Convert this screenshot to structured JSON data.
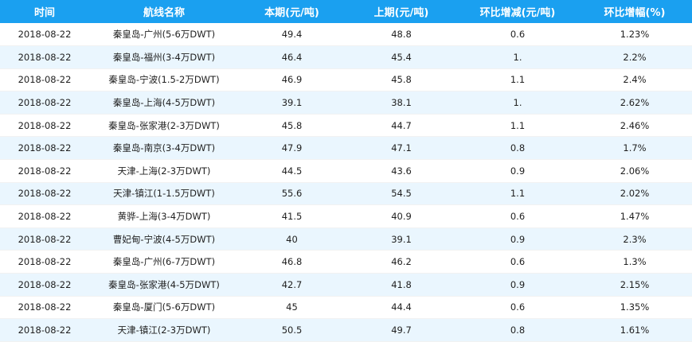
{
  "headers": [
    "时间",
    "航线名称",
    "本期(元/吨)",
    "上期(元/吨)",
    "环比增减(元/吨)",
    "环比增幅(%)"
  ],
  "colors": {
    "header_bg": "#1aa0f0",
    "header_text": "#ffffff",
    "stripe": "#eaf6fe"
  },
  "rows": [
    [
      "2018-08-22",
      "秦皇岛-广州(5-6万DWT)",
      "49.4",
      "48.8",
      "0.6",
      "1.23%"
    ],
    [
      "2018-08-22",
      "秦皇岛-福州(3-4万DWT)",
      "46.4",
      "45.4",
      "1.",
      "2.2%"
    ],
    [
      "2018-08-22",
      "秦皇岛-宁波(1.5-2万DWT)",
      "46.9",
      "45.8",
      "1.1",
      "2.4%"
    ],
    [
      "2018-08-22",
      "秦皇岛-上海(4-5万DWT)",
      "39.1",
      "38.1",
      "1.",
      "2.62%"
    ],
    [
      "2018-08-22",
      "秦皇岛-张家港(2-3万DWT)",
      "45.8",
      "44.7",
      "1.1",
      "2.46%"
    ],
    [
      "2018-08-22",
      "秦皇岛-南京(3-4万DWT)",
      "47.9",
      "47.1",
      "0.8",
      "1.7%"
    ],
    [
      "2018-08-22",
      "天津-上海(2-3万DWT)",
      "44.5",
      "43.6",
      "0.9",
      "2.06%"
    ],
    [
      "2018-08-22",
      "天津-镇江(1-1.5万DWT)",
      "55.6",
      "54.5",
      "1.1",
      "2.02%"
    ],
    [
      "2018-08-22",
      "黄骅-上海(3-4万DWT)",
      "41.5",
      "40.9",
      "0.6",
      "1.47%"
    ],
    [
      "2018-08-22",
      "曹妃甸-宁波(4-5万DWT)",
      "40",
      "39.1",
      "0.9",
      "2.3%"
    ],
    [
      "2018-08-22",
      "秦皇岛-广州(6-7万DWT)",
      "46.8",
      "46.2",
      "0.6",
      "1.3%"
    ],
    [
      "2018-08-22",
      "秦皇岛-张家港(4-5万DWT)",
      "42.7",
      "41.8",
      "0.9",
      "2.15%"
    ],
    [
      "2018-08-22",
      "秦皇岛-厦门(5-6万DWT)",
      "45",
      "44.4",
      "0.6",
      "1.35%"
    ],
    [
      "2018-08-22",
      "天津-镇江(2-3万DWT)",
      "50.5",
      "49.7",
      "0.8",
      "1.61%"
    ]
  ]
}
